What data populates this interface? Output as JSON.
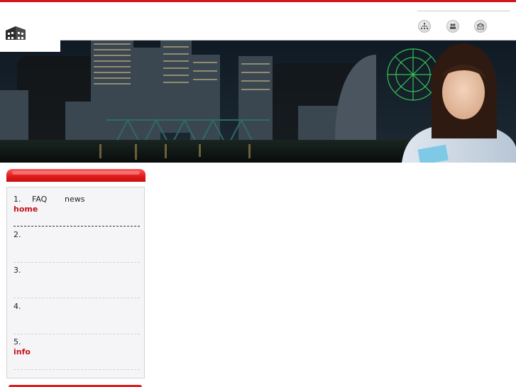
{
  "colors": {
    "accent_red": "#d8131b",
    "link_red": "#c4141b",
    "panel_bg": "#f5f5f7",
    "border_grey": "#d4d4d4"
  },
  "header": {
    "logo_icon": "building-logo-icon",
    "icons": [
      "sitemap-icon",
      "users-icon",
      "contact-icon"
    ]
  },
  "banner": {
    "image_description_icon": "city-night-banner-image"
  },
  "sidebar": {
    "item1": {
      "number": "1.",
      "faq_label": "FAQ",
      "news_label": "news",
      "link": "home"
    },
    "item2": {
      "number": "2."
    },
    "item3": {
      "number": "3."
    },
    "item4": {
      "number": "4."
    },
    "item5": {
      "number": "5.",
      "link": "info"
    }
  }
}
